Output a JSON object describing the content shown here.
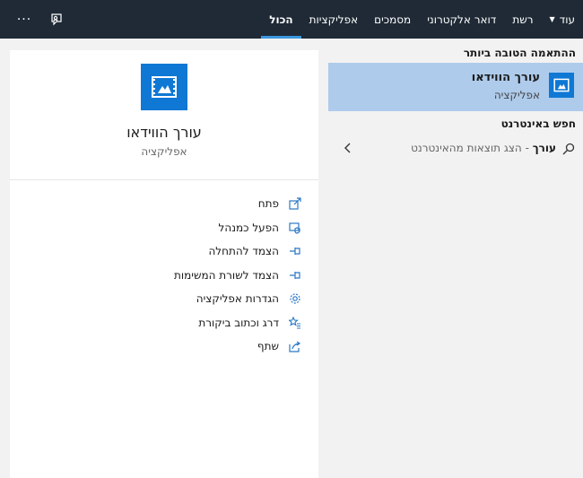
{
  "tabs": [
    {
      "label": "הכול",
      "active": true
    },
    {
      "label": "אפליקציות",
      "active": false
    },
    {
      "label": "מסמכים",
      "active": false
    },
    {
      "label": "דואר אלקטרוני",
      "active": false
    },
    {
      "label": "רשת",
      "active": false
    },
    {
      "label": "עוד",
      "active": false
    }
  ],
  "topbar": {
    "feedback_icon": "feedback-icon",
    "more_icon": "ellipsis-icon",
    "more_glyph": "···"
  },
  "best_match": {
    "heading": "ההתאמה הטובה ביותר",
    "title": "עורך הווידאו",
    "subtitle": "אפליקציה"
  },
  "web": {
    "heading": "חפש באינטרנט",
    "query": "עורך",
    "rest": " - הצג תוצאות מהאינטרנט"
  },
  "preview": {
    "title": "עורך הווידאו",
    "subtitle": "אפליקציה",
    "actions": [
      {
        "label": "פתח",
        "icon": "open-icon"
      },
      {
        "label": "הפעל כמנהל",
        "icon": "run-as-admin-icon"
      },
      {
        "label": "הצמד להתחלה",
        "icon": "pin-start-icon"
      },
      {
        "label": "הצמד לשורת המשימות",
        "icon": "pin-taskbar-icon"
      },
      {
        "label": "הגדרות אפליקציה",
        "icon": "settings-icon"
      },
      {
        "label": "דרג וכתוב ביקורת",
        "icon": "rate-review-icon"
      },
      {
        "label": "שתף",
        "icon": "share-icon"
      }
    ]
  },
  "colors": {
    "topbar": "#1f2a36",
    "accent": "#0f78d4",
    "selected": "#aecbeb"
  }
}
